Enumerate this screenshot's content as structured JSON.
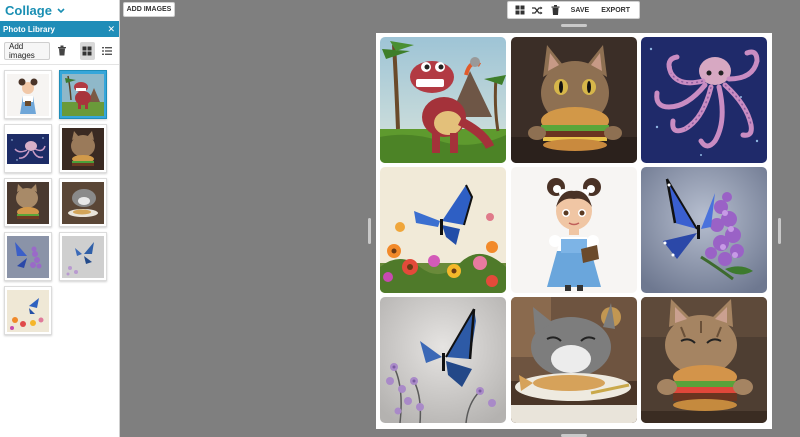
{
  "app": {
    "title": "Collage"
  },
  "sidebar": {
    "panel_title": "Photo Library",
    "add_images_label": "Add images",
    "thumbnails": [
      {
        "subject": "girl with book"
      },
      {
        "subject": "dinosaur",
        "selected": true
      },
      {
        "subject": "octopus"
      },
      {
        "subject": "cat with burger"
      },
      {
        "subject": "cat with burger"
      },
      {
        "subject": "cat eating fish"
      },
      {
        "subject": "blue butterfly on lilac"
      },
      {
        "subject": "butterfly on grey"
      },
      {
        "subject": "butterfly with flowers"
      }
    ]
  },
  "toolbar": {
    "add_images_label": "ADD IMAGES",
    "save_label": "SAVE",
    "export_label": "EXPORT"
  },
  "collage": {
    "cells": [
      {
        "subject": "dinosaur"
      },
      {
        "subject": "cat with burger"
      },
      {
        "subject": "octopus"
      },
      {
        "subject": "butterfly with flowers"
      },
      {
        "subject": "girl with book"
      },
      {
        "subject": "blue butterfly on lilac"
      },
      {
        "subject": "butterfly on grey"
      },
      {
        "subject": "cat eating fish"
      },
      {
        "subject": "cat with burger"
      }
    ]
  },
  "colors": {
    "accent": "#1f8db8",
    "selected_thumb": "#36a6da",
    "workspace": "#7f7f7f"
  }
}
